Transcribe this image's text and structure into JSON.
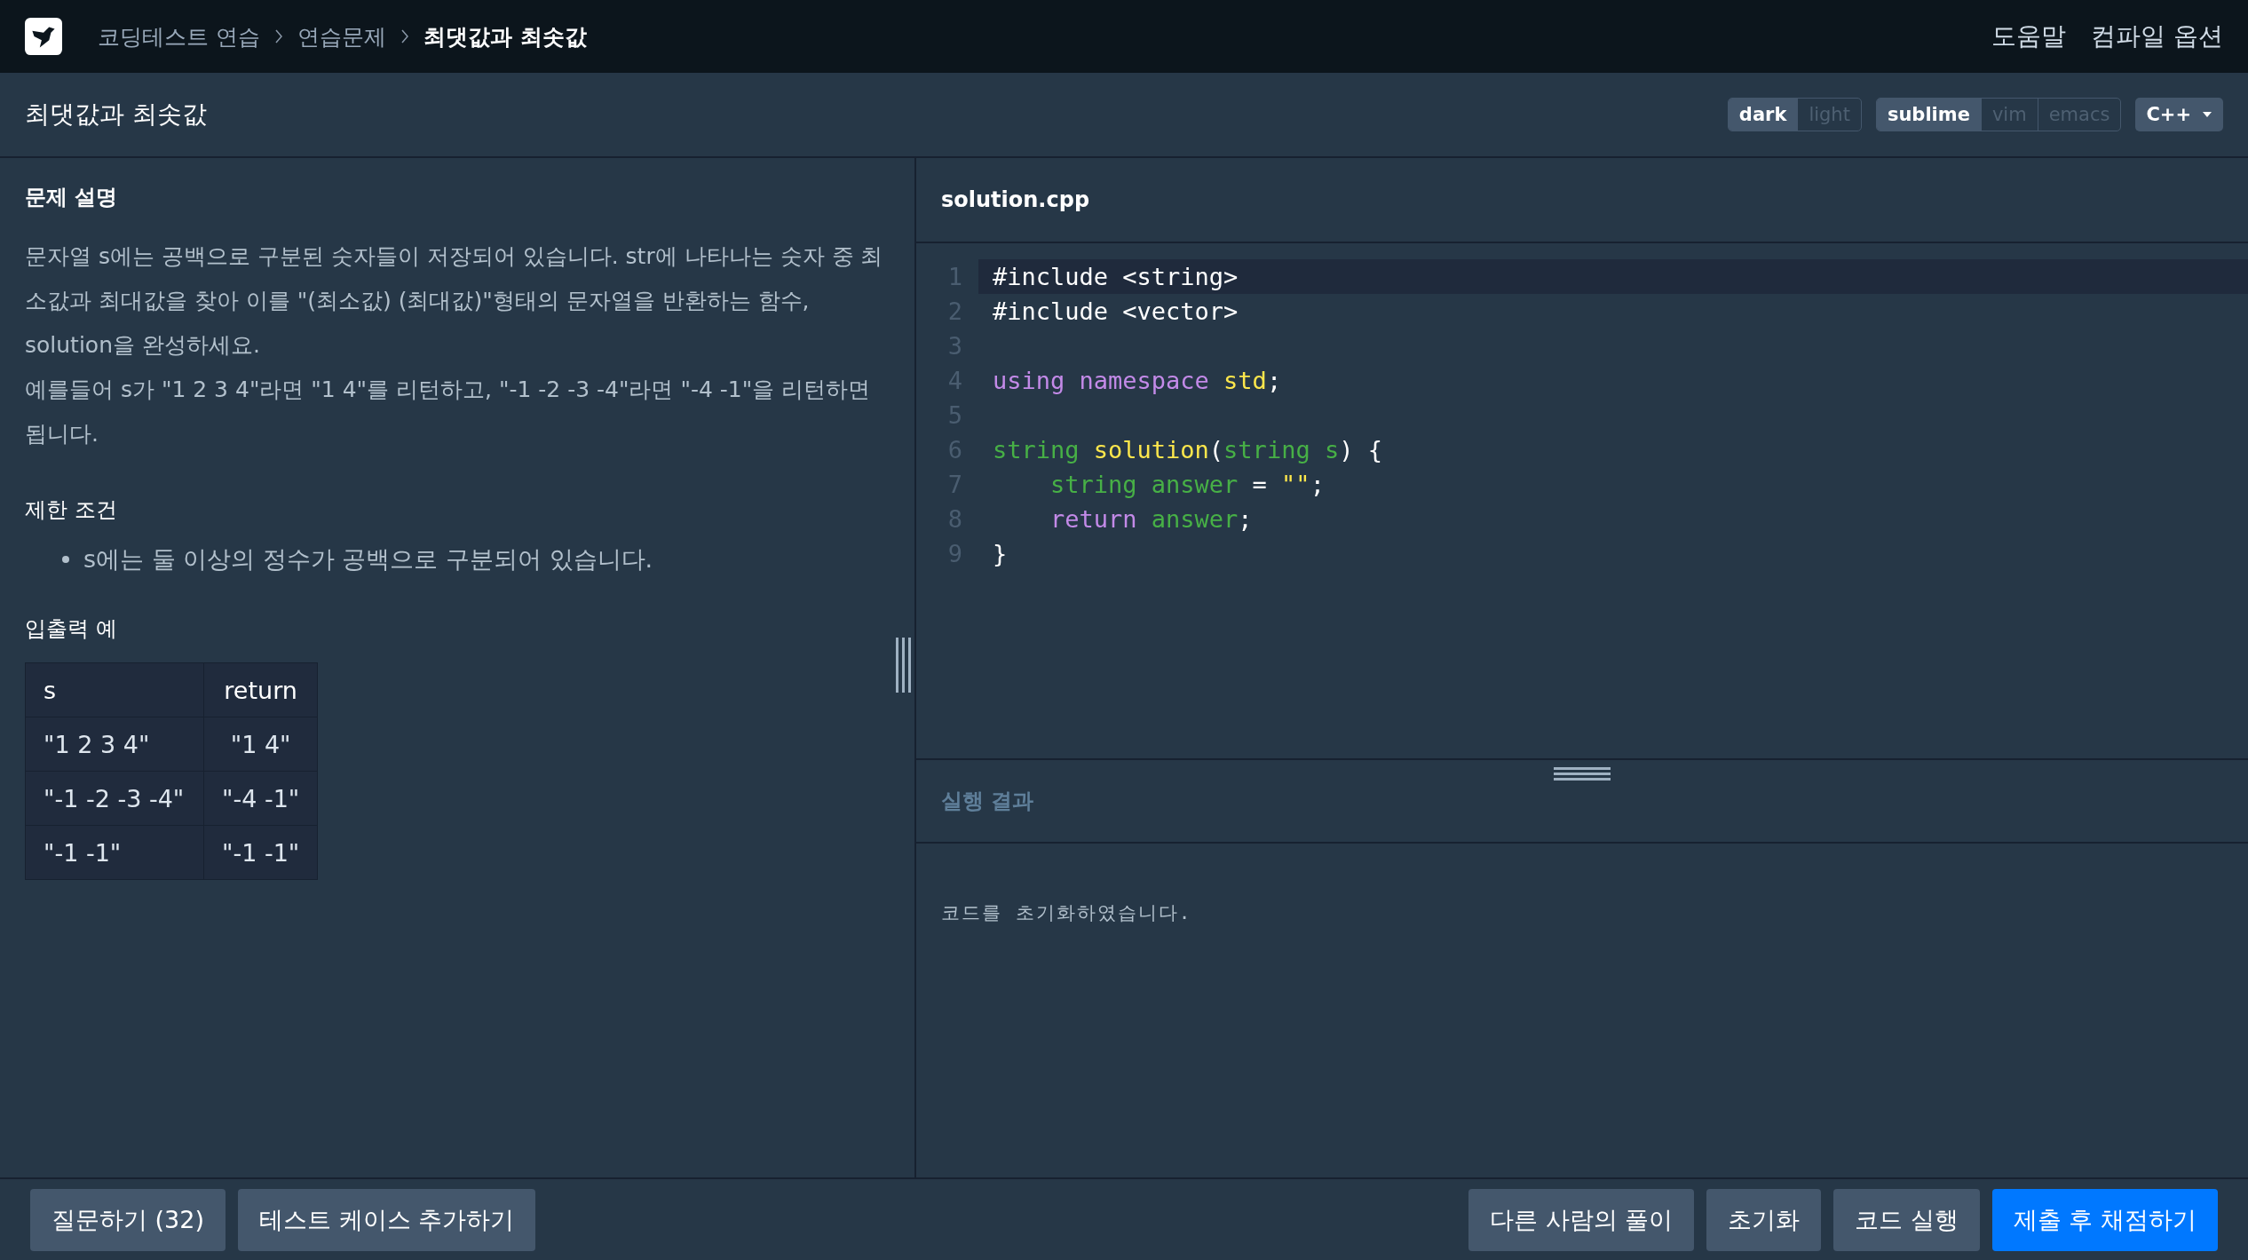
{
  "breadcrumb": [
    {
      "label": "코딩테스트 연습",
      "current": false
    },
    {
      "label": "연습문제",
      "current": false
    },
    {
      "label": "최댓값과 최솟값",
      "current": true
    }
  ],
  "nav_links": [
    "도움말",
    "컴파일 옵션"
  ],
  "page_title": "최댓값과 최솟값",
  "toggle_groups": [
    {
      "options": [
        {
          "label": "dark",
          "selected": true
        },
        {
          "label": "light",
          "selected": false
        }
      ]
    },
    {
      "options": [
        {
          "label": "sublime",
          "selected": true
        },
        {
          "label": "vim",
          "selected": false
        },
        {
          "label": "emacs",
          "selected": false
        }
      ]
    }
  ],
  "language_dropdown": "C++",
  "description": {
    "heading": "문제 설명",
    "paragraphs": [
      "문자열 s에는 공백으로 구분된 숫자들이 저장되어 있습니다. str에 나타나는 숫자 중 최소값과 최대값을 찾아 이를 \"(최소값) (최대값)\"형태의 문자열을 반환하는 함수, solution을 완성하세요.",
      "예를들어 s가 \"1 2 3 4\"라면 \"1 4\"를 리턴하고, \"-1 -2 -3 -4\"라면 \"-4 -1\"을 리턴하면 됩니다."
    ]
  },
  "constraints": {
    "heading": "제한 조건",
    "items": [
      "s에는 둘 이상의 정수가 공백으로 구분되어 있습니다."
    ]
  },
  "examples": {
    "heading": "입출력 예",
    "columns": [
      "s",
      "return"
    ],
    "rows": [
      [
        "\"1 2 3 4\"",
        "\"1 4\""
      ],
      [
        "\"-1 -2 -3 -4\"",
        "\"-4 -1\""
      ],
      [
        "\"-1 -1\"",
        "\"-1 -1\""
      ]
    ]
  },
  "editor": {
    "filename": "solution.cpp",
    "lines": [
      {
        "number": "1",
        "active": true,
        "tokens": [
          {
            "kind": "plain",
            "text": "#include <string>"
          }
        ]
      },
      {
        "number": "2",
        "active": false,
        "tokens": [
          {
            "kind": "plain",
            "text": "#include <vector>"
          }
        ]
      },
      {
        "number": "3",
        "active": false
      },
      {
        "number": "4",
        "active": false,
        "tokens": [
          {
            "kind": "keyword",
            "text": "using namespace "
          },
          {
            "kind": "func",
            "text": "std"
          },
          {
            "kind": "plain",
            "text": ";"
          }
        ]
      },
      {
        "number": "5",
        "active": false
      },
      {
        "number": "6",
        "active": false,
        "tokens": [
          {
            "kind": "type",
            "text": "string "
          },
          {
            "kind": "func",
            "text": "solution"
          },
          {
            "kind": "plain",
            "text": "("
          },
          {
            "kind": "type",
            "text": "string s"
          },
          {
            "kind": "plain",
            "text": ") {"
          }
        ]
      },
      {
        "number": "7",
        "active": false,
        "indented": true,
        "tokens": [
          {
            "kind": "type",
            "text": "string answer"
          },
          {
            "kind": "plain",
            "text": " = "
          },
          {
            "kind": "string",
            "text": "\"\""
          },
          {
            "kind": "plain",
            "text": ";"
          }
        ]
      },
      {
        "number": "8",
        "active": false,
        "indented": true,
        "tokens": [
          {
            "kind": "keyword",
            "text": "return "
          },
          {
            "kind": "type",
            "text": "answer"
          },
          {
            "kind": "plain",
            "text": ";"
          }
        ]
      },
      {
        "number": "9",
        "active": false,
        "tokens": [
          {
            "kind": "plain",
            "text": "}"
          }
        ]
      }
    ]
  },
  "result": {
    "heading": "실행 결과",
    "message": "코드를 초기화하였습니다."
  },
  "buttons_left": [
    {
      "label": "질문하기 (32)",
      "kind": "secondary"
    },
    {
      "label": "테스트 케이스 추가하기",
      "kind": "secondary"
    }
  ],
  "buttons_right": [
    {
      "label": "다른 사람의 풀이",
      "kind": "secondary"
    },
    {
      "label": "초기화",
      "kind": "secondary"
    },
    {
      "label": "코드 실행",
      "kind": "secondary"
    },
    {
      "label": "제출 후 채점하기",
      "kind": "primary"
    }
  ]
}
